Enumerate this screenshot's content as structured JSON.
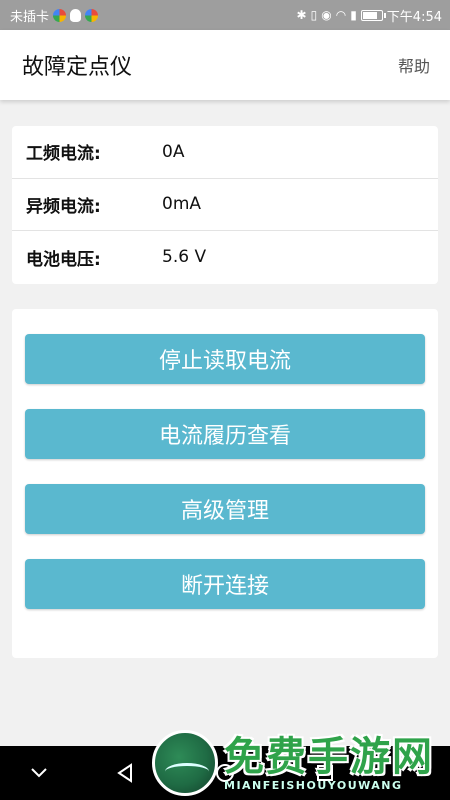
{
  "status_bar": {
    "carrier": "未插卡",
    "time": "下午4:54"
  },
  "app_bar": {
    "title": "故障定点仪",
    "help": "帮助"
  },
  "info": [
    {
      "label": "工频电流:",
      "value": "0A"
    },
    {
      "label": "异频电流:",
      "value": "0mA"
    },
    {
      "label": "电池电压:",
      "value": "5.6 V"
    }
  ],
  "actions": [
    {
      "label": "停止读取电流"
    },
    {
      "label": "电流履历查看"
    },
    {
      "label": "高级管理"
    },
    {
      "label": "断开连接"
    }
  ],
  "watermark": {
    "title": "免费手游网",
    "subtitle": "MIANFEISHOUYOUWANG"
  },
  "colors": {
    "button": "#5ab8cf",
    "status_bar": "#9e9e9e",
    "nav_bar": "#000000"
  }
}
